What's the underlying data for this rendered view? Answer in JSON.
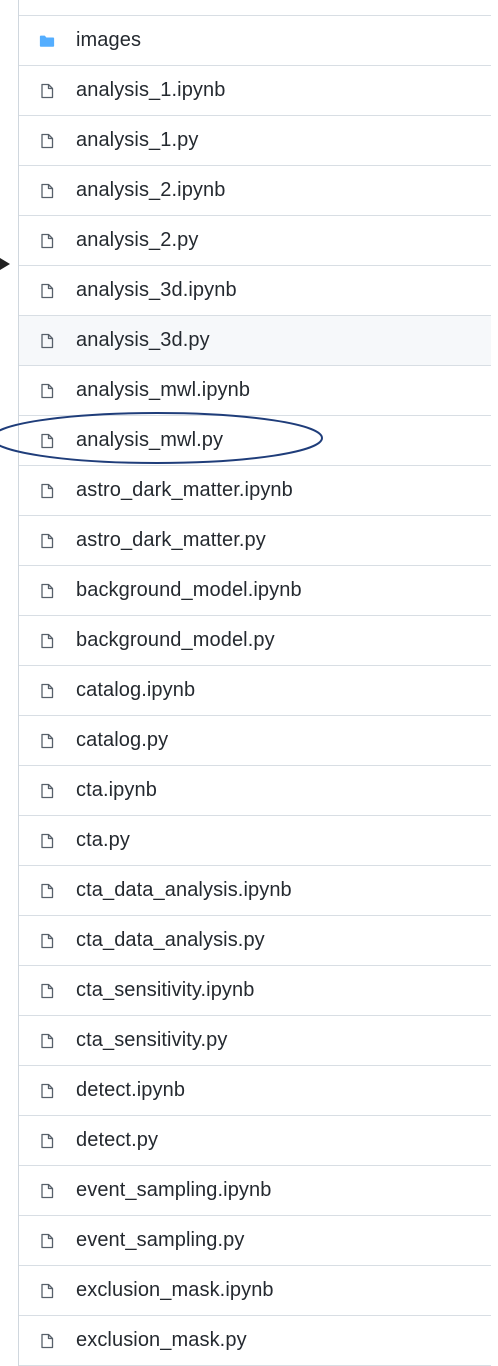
{
  "file_list": {
    "folders": [
      {
        "name": "images",
        "icon": "folder-icon"
      }
    ],
    "files": [
      {
        "name": "analysis_1.ipynb",
        "icon": "file-icon"
      },
      {
        "name": "analysis_1.py",
        "icon": "file-icon"
      },
      {
        "name": "analysis_2.ipynb",
        "icon": "file-icon"
      },
      {
        "name": "analysis_2.py",
        "icon": "file-icon"
      },
      {
        "name": "analysis_3d.ipynb",
        "icon": "file-icon"
      },
      {
        "name": "analysis_3d.py",
        "icon": "file-icon"
      },
      {
        "name": "analysis_mwl.ipynb",
        "icon": "file-icon"
      },
      {
        "name": "analysis_mwl.py",
        "icon": "file-icon"
      },
      {
        "name": "astro_dark_matter.ipynb",
        "icon": "file-icon"
      },
      {
        "name": "astro_dark_matter.py",
        "icon": "file-icon"
      },
      {
        "name": "background_model.ipynb",
        "icon": "file-icon"
      },
      {
        "name": "background_model.py",
        "icon": "file-icon"
      },
      {
        "name": "catalog.ipynb",
        "icon": "file-icon"
      },
      {
        "name": "catalog.py",
        "icon": "file-icon"
      },
      {
        "name": "cta.ipynb",
        "icon": "file-icon"
      },
      {
        "name": "cta.py",
        "icon": "file-icon"
      },
      {
        "name": "cta_data_analysis.ipynb",
        "icon": "file-icon"
      },
      {
        "name": "cta_data_analysis.py",
        "icon": "file-icon"
      },
      {
        "name": "cta_sensitivity.ipynb",
        "icon": "file-icon"
      },
      {
        "name": "cta_sensitivity.py",
        "icon": "file-icon"
      },
      {
        "name": "detect.ipynb",
        "icon": "file-icon"
      },
      {
        "name": "detect.py",
        "icon": "file-icon"
      },
      {
        "name": "event_sampling.ipynb",
        "icon": "file-icon"
      },
      {
        "name": "event_sampling.py",
        "icon": "file-icon"
      },
      {
        "name": "exclusion_mask.ipynb",
        "icon": "file-icon"
      },
      {
        "name": "exclusion_mask.py",
        "icon": "file-icon"
      }
    ],
    "hovered_file": "analysis_3d.py",
    "circled_file": "analysis_mwl.py",
    "arrow_target_file": "analysis_2.py"
  },
  "colors": {
    "text": "#24292f",
    "file_icon": "#57606a",
    "folder_icon": "#54aeff",
    "row_border": "#d8dee4",
    "hover_background": "#f6f8fa",
    "annotation_ellipse": "#1f3d7a",
    "annotation_arrow": "#222222"
  }
}
